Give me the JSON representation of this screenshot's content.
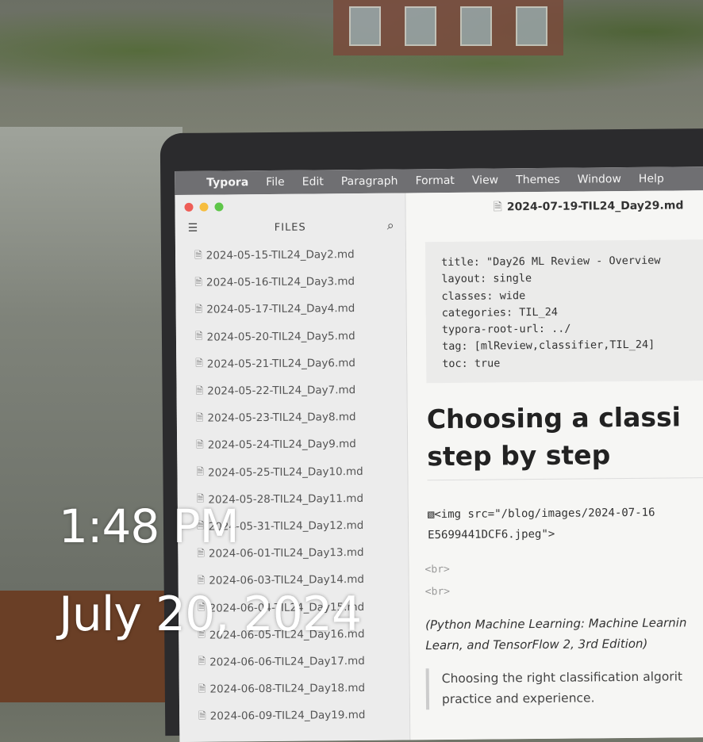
{
  "menubar": {
    "apple": "",
    "app": "Typora",
    "items": [
      "File",
      "Edit",
      "Paragraph",
      "Format",
      "View",
      "Themes",
      "Window",
      "Help"
    ]
  },
  "sidebar": {
    "title": "FILES",
    "files": [
      "2024-05-15-TIL24_Day2.md",
      "2024-05-16-TIL24_Day3.md",
      "2024-05-17-TIL24_Day4.md",
      "2024-05-20-TIL24_Day5.md",
      "2024-05-21-TIL24_Day6.md",
      "2024-05-22-TIL24_Day7.md",
      "2024-05-23-TIL24_Day8.md",
      "2024-05-24-TIL24_Day9.md",
      "2024-05-25-TIL24_Day10.md",
      "2024-05-28-TIL24_Day11.md",
      "2024-05-31-TIL24_Day12.md",
      "2024-06-01-TIL24_Day13.md",
      "2024-06-03-TIL24_Day14.md",
      "2024-06-04-TIL24_Day15.md",
      "2024-06-05-TIL24_Day16.md",
      "2024-06-06-TIL24_Day17.md",
      "2024-06-08-TIL24_Day18.md",
      "2024-06-09-TIL24_Day19.md"
    ]
  },
  "editor": {
    "doc_title": "2024-07-19-TIL24_Day29.md",
    "frontmatter": [
      "title: \"Day26 ML Review - Overview",
      "layout: single",
      "classes: wide",
      "categories: TIL_24",
      "typora-root-url: ../",
      "tag: [mlReview,classifier,TIL_24]",
      "toc: true"
    ],
    "heading_line1": "Choosing a classi",
    "heading_line2": "step by step",
    "img_line1": "<img src=\"/blog/images/2024-07-16",
    "img_line2": "E5699441DCF6.jpeg\">",
    "br1": "<br>",
    "br2": "<br>",
    "italic_line1": "(Python Machine Learning: Machine Learnin",
    "italic_line2": "Learn, and TensorFlow 2, 3rd Edition)",
    "quote_line1": "Choosing the right classification algorit",
    "quote_line2": "practice and experience."
  },
  "overlay": {
    "time": "1:48 PM",
    "date": "July 20, 2024"
  }
}
